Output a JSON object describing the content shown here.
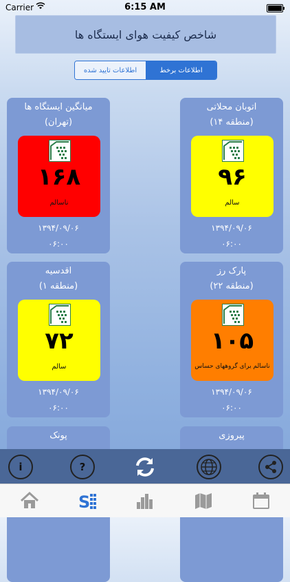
{
  "status_bar": {
    "carrier": "Carrier",
    "time": "6:15 AM"
  },
  "header": {
    "title": "شاخص کیفیت هوای ایستگاه ها"
  },
  "segment": {
    "confirmed_label": "اطلاعات تایید شده",
    "live_label": "اطلاعات برخط",
    "selected": "live"
  },
  "stations": [
    {
      "name": "اتوبان محلاتی",
      "region": "(منطقه ۱۴)",
      "aqi": "۹۶",
      "status": "سالم",
      "date": "۱۳۹۴/۰۹/۰۶",
      "time": "۰۶:۰۰",
      "color": "#ffff00"
    },
    {
      "name": "میانگین ایستگاه ها",
      "region": "(تهران)",
      "aqi": "۱۶۸",
      "status": "ناسالم",
      "date": "۱۳۹۴/۰۹/۰۶",
      "time": "۰۶:۰۰",
      "color": "#ff0000"
    },
    {
      "name": "پارک رز",
      "region": "(منطقه ۲۲)",
      "aqi": "۱۰۵",
      "status": "ناسالم برای گروههای حساس",
      "date": "۱۳۹۴/۰۹/۰۶",
      "time": "۰۶:۰۰",
      "color": "#ff7e00"
    },
    {
      "name": "اقدسیه",
      "region": "(منطقه ۱)",
      "aqi": "۷۲",
      "status": "سالم",
      "date": "۱۳۹۴/۰۹/۰۶",
      "time": "۰۶:۰۰",
      "color": "#ffff00"
    },
    {
      "name": "پیروزی"
    },
    {
      "name": "پونک"
    }
  ],
  "toolbar_icons": [
    "share-icon",
    "globe-icon",
    "refresh-icon",
    "help-icon",
    "info-icon"
  ],
  "tab_icons": [
    "calendar-icon",
    "map-icon",
    "chart-icon",
    "stations-icon",
    "home-icon"
  ],
  "active_tab": "stations-icon"
}
